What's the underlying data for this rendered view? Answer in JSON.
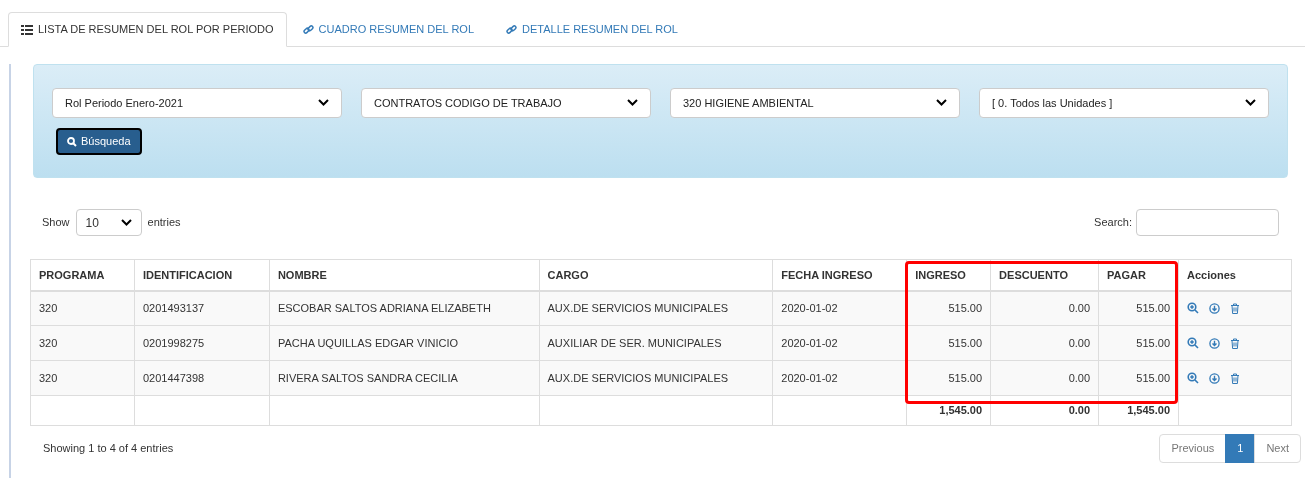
{
  "tabs": [
    {
      "label": "LISTA DE RESUMEN DEL ROL POR PERIODO",
      "kind": "list",
      "selected": true
    },
    {
      "label": "CUADRO RESUMEN DEL ROL",
      "kind": "link",
      "selected": false
    },
    {
      "label": "DETALLE RESUMEN DEL ROL",
      "kind": "link",
      "selected": false
    }
  ],
  "filters": [
    "Rol Periodo Enero-2021",
    "CONTRATOS CODIGO DE TRABAJO",
    "320 HIGIENE AMBIENTAL",
    "[ 0. Todos las Unidades ]"
  ],
  "search_button": "Búsqueda",
  "length": {
    "before": "Show",
    "value": "10",
    "after": "entries"
  },
  "search": {
    "label": "Search:"
  },
  "table": {
    "columns": [
      "PROGRAMA",
      "IDENTIFICACION",
      "NOMBRE",
      "CARGO",
      "FECHA INGRESO",
      "INGRESO",
      "DESCUENTO",
      "PAGAR",
      "Acciones"
    ],
    "rows": [
      {
        "cells": [
          "320",
          "0201493137",
          "ESCOBAR SALTOS ADRIANA ELIZABETH",
          "AUX.DE SERVICIOS MUNICIPALES",
          "2020-01-02",
          "515.00",
          "0.00",
          "515.00"
        ]
      },
      {
        "cells": [
          "320",
          "0201998275",
          "PACHA UQUILLAS EDGAR VINICIO",
          "AUXILIAR DE SER. MUNICIPALES",
          "2020-01-02",
          "515.00",
          "0.00",
          "515.00"
        ]
      },
      {
        "cells": [
          "320",
          "0201447398",
          "RIVERA SALTOS SANDRA CECILIA",
          "AUX.DE SERVICIOS MUNICIPALES",
          "2020-01-02",
          "515.00",
          "0.00",
          "515.00"
        ]
      }
    ],
    "totals": [
      "1,545.00",
      "0.00",
      "1,545.00"
    ]
  },
  "info": "Showing 1 to 4 of 4 entries",
  "pagination": [
    {
      "label": "Previous",
      "kind": "prev",
      "selected": false
    },
    {
      "label": "1",
      "kind": "page",
      "selected": true
    },
    {
      "label": "Next",
      "kind": "next",
      "selected": false
    }
  ]
}
